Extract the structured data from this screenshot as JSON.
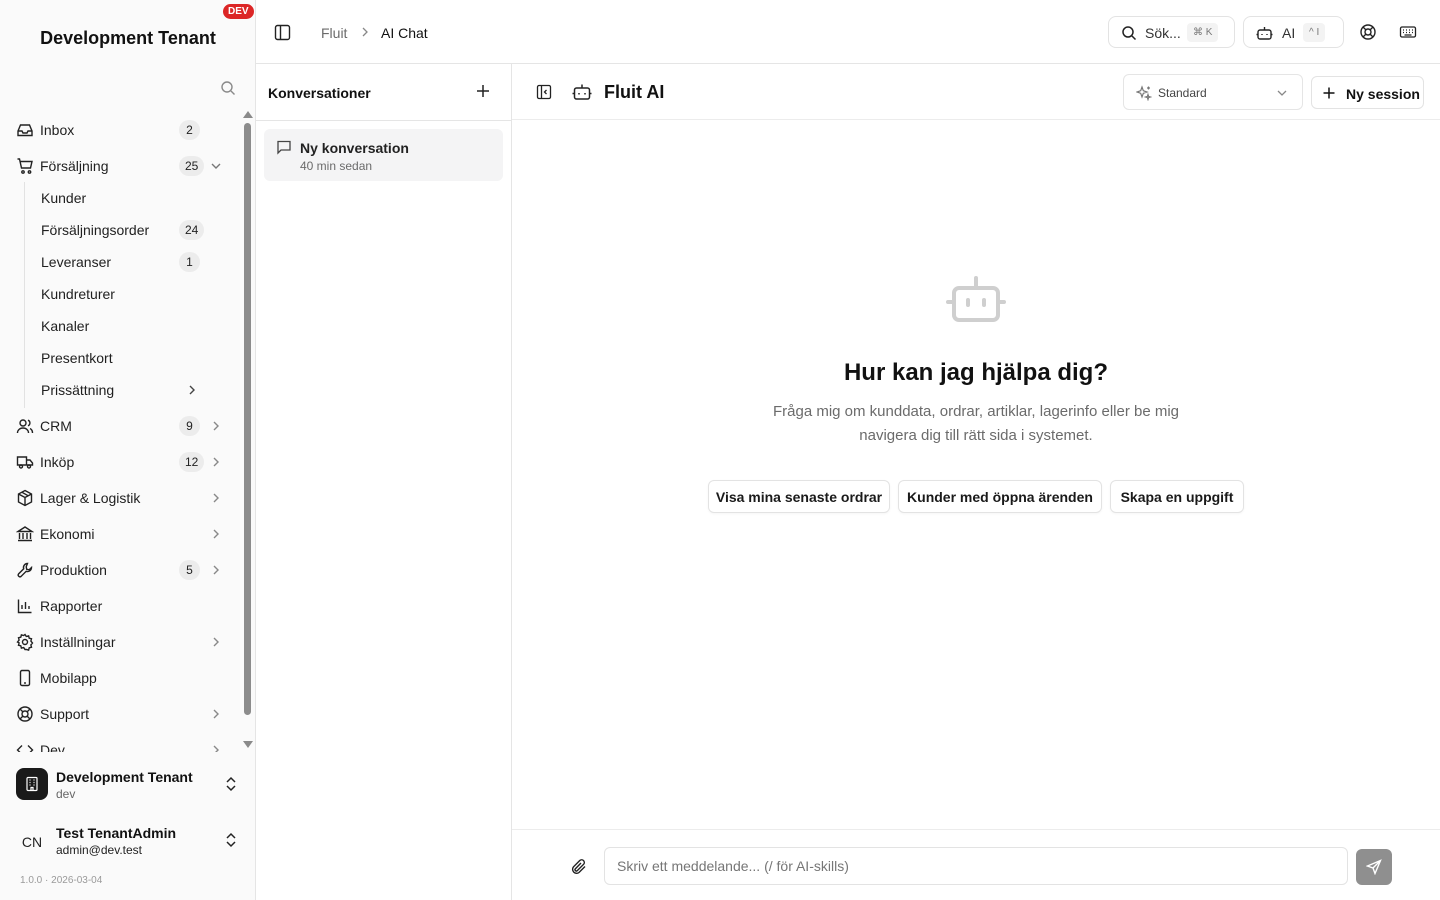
{
  "sidebar": {
    "tenant_title": "Development Tenant",
    "env_badge": "DEV",
    "items": [
      {
        "label": "Inbox",
        "count": "2",
        "icon": "inbox-icon"
      },
      {
        "label": "Försäljning",
        "count": "25",
        "icon": "shopping-cart-icon",
        "expanded": true
      },
      {
        "label": "Kunder"
      },
      {
        "label": "Försäljningsorder",
        "count": "24"
      },
      {
        "label": "Leveranser",
        "count": "1"
      },
      {
        "label": "Kundreturer"
      },
      {
        "label": "Kanaler"
      },
      {
        "label": "Presentkort"
      },
      {
        "label": "Prissättning"
      },
      {
        "label": "CRM",
        "count": "9",
        "icon": "users-icon"
      },
      {
        "label": "Inköp",
        "count": "12",
        "icon": "truck-icon"
      },
      {
        "label": "Lager & Logistik",
        "icon": "package-icon"
      },
      {
        "label": "Ekonomi",
        "icon": "bank-icon"
      },
      {
        "label": "Produktion",
        "count": "5",
        "icon": "wrench-icon"
      },
      {
        "label": "Rapporter",
        "icon": "bar-chart-icon"
      },
      {
        "label": "Inställningar",
        "icon": "gear-icon"
      },
      {
        "label": "Mobilapp",
        "icon": "smartphone-icon"
      },
      {
        "label": "Support",
        "icon": "lifebuoy-icon"
      },
      {
        "label": "Dev",
        "icon": "code-icon"
      }
    ],
    "tenant_switcher": {
      "name": "Development Tenant",
      "slug": "dev"
    },
    "user": {
      "initials": "CN",
      "name": "Test TenantAdmin",
      "email": "admin@dev.test"
    },
    "version": "1.0.0 · 2026-03-04"
  },
  "topbar": {
    "breadcrumb": [
      "Fluit",
      "AI Chat"
    ],
    "search_label": "Sök...",
    "search_shortcut": "⌘ K",
    "ai_label": "AI",
    "ai_shortcut": "^ I"
  },
  "conversations": {
    "title": "Konversationer",
    "items": [
      {
        "title": "Ny konversation",
        "time": "40 min sedan"
      }
    ]
  },
  "chat": {
    "title": "Fluit AI",
    "model": "Standard",
    "new_session": "Ny session",
    "welcome_title": "Hur kan jag hjälpa dig?",
    "welcome_subtitle": "Fråga mig om kunddata, ordrar, artiklar, lagerinfo eller be mig navigera dig till rätt sida i systemet.",
    "suggestions": [
      "Visa mina senaste ordrar",
      "Kunder med öppna ärenden",
      "Skapa en uppgift"
    ],
    "input_placeholder": "Skriv ett meddelande... (/ för AI-skills)"
  },
  "colors": {
    "dev_badge": "#dc2626",
    "send_button": "#8f8f8f",
    "active_conversation": "#f4f4f5"
  }
}
